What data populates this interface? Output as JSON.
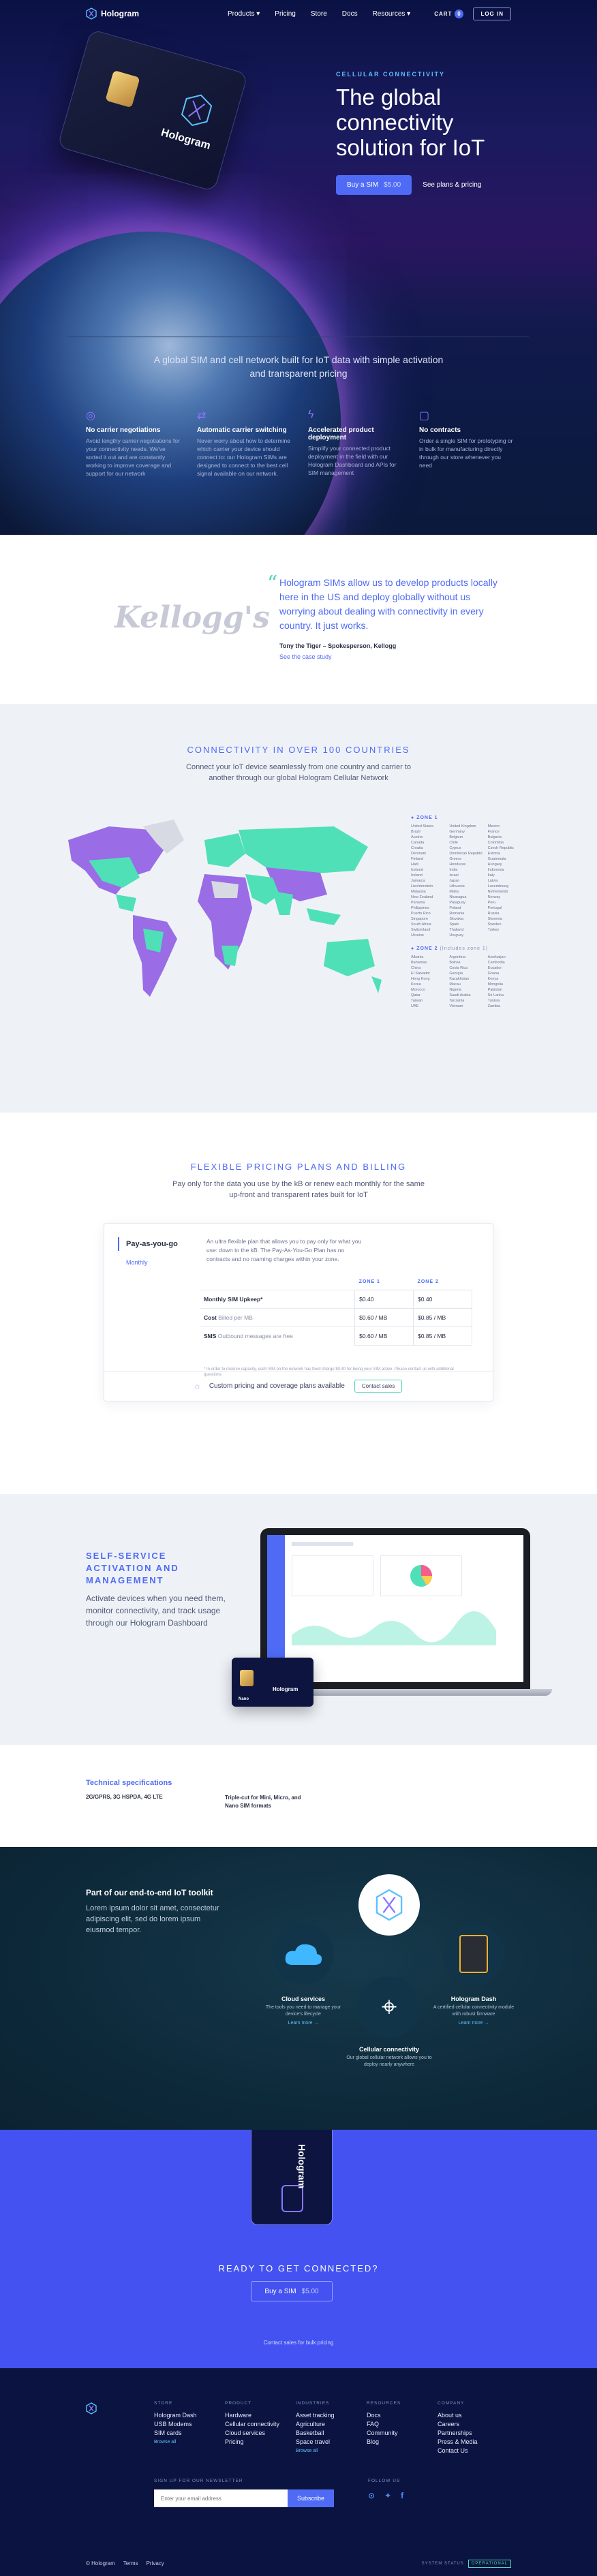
{
  "nav": {
    "brand": "Hologram",
    "links": [
      "Products",
      "Pricing",
      "Store",
      "Docs",
      "Resources"
    ],
    "cart": "CART",
    "cart_count": "0",
    "login": "LOG IN"
  },
  "hero": {
    "sim_label": "Hologram",
    "eyebrow": "CELLULAR CONNECTIVITY",
    "title": "The global connectivity solution for IoT",
    "buy_label": "Buy a SIM",
    "buy_price": "$5.00",
    "plans_link": "See plans & pricing",
    "subtitle": "A global SIM and cell network built for IoT data with simple activation and transparent pricing",
    "features": [
      {
        "icon": "globe-icon",
        "title": "No carrier negotiations",
        "text": "Avoid lengthy carrier negotiations for your connectivity needs. We've sorted it out and are constantly working to improve coverage and support for our network"
      },
      {
        "icon": "switch-icon",
        "title": "Automatic carrier switching",
        "text": "Never worry about how to determine which carrier your device should connect to: our Hologram SIMs are designed to connect to the best cell signal available on our network."
      },
      {
        "icon": "bolt-icon",
        "title": "Accelerated product deployment",
        "text": "Simplify your connected product deployment in the field with our Hologram Dashboard and APIs for SIM management"
      },
      {
        "icon": "contract-icon",
        "title": "No contracts",
        "text": "Order a single SIM for prototyping or in bulk for manufacturing directly through our store whenever you need"
      }
    ]
  },
  "testimonial": {
    "logo_text": "Kellogg's",
    "quote": "Hologram SIMs allow us to develop products locally here in the US and deploy globally without us worrying about dealing with connectivity in every country. It just works.",
    "author": "Tony the Tiger – Spokesperson, Kellogg",
    "case_link": "See the case study"
  },
  "coverage": {
    "title": "CONNECTIVITY IN OVER 100 COUNTRIES",
    "subtitle": "Connect your IoT device seamlessly from one country and carrier to another through our global Hologram Cellular Network",
    "zone1_title": "ZONE 1",
    "zone1": [
      "United States",
      "United Kingdom",
      "Mexico",
      "Brazil",
      "Germany",
      "France",
      "Austria",
      "Belgium",
      "Bulgaria",
      "Canada",
      "Chile",
      "Colombia",
      "Croatia",
      "Cyprus",
      "Czech Republic",
      "Denmark",
      "Dominican Republic",
      "Estonia",
      "Finland",
      "Greece",
      "Guatemala",
      "Haiti",
      "Honduras",
      "Hungary",
      "Iceland",
      "India",
      "Indonesia",
      "Ireland",
      "Israel",
      "Italy",
      "Jamaica",
      "Japan",
      "Latvia",
      "Liechtenstein",
      "Lithuania",
      "Luxembourg",
      "Malaysia",
      "Malta",
      "Netherlands",
      "New Zealand",
      "Nicaragua",
      "Norway",
      "Panama",
      "Paraguay",
      "Peru",
      "Philippines",
      "Poland",
      "Portugal",
      "Puerto Rico",
      "Romania",
      "Russia",
      "Singapore",
      "Slovakia",
      "Slovenia",
      "South Africa",
      "Spain",
      "Sweden",
      "Switzerland",
      "Thailand",
      "Turkey",
      "Ukraine",
      "Uruguay"
    ],
    "zone2_title": "ZONE 2",
    "zone2_note": "(Includes zone 1)",
    "zone2": [
      "Albania",
      "Argentina",
      "Azerbaijan",
      "Bahamas",
      "Bolivia",
      "Cambodia",
      "China",
      "Costa Rica",
      "Ecuador",
      "El Salvador",
      "Georgia",
      "Ghana",
      "Hong Kong",
      "Kazakhstan",
      "Kenya",
      "Korea",
      "Macau",
      "Mongolia",
      "Morocco",
      "Nigeria",
      "Pakistan",
      "Qatar",
      "Saudi Arabia",
      "Sri Lanka",
      "Taiwan",
      "Tanzania",
      "Tunisia",
      "UAE",
      "Vietnam",
      "Zambia"
    ]
  },
  "pricing": {
    "title": "FLEXIBLE PRICING PLANS AND BILLING",
    "subtitle": "Pay only for the data you use by the kB or renew each monthly for the same up-front and transparent rates built for IoT",
    "tab_active": "Pay-as-you-go",
    "tab_other": "Monthly",
    "description": "An ultra flexible plan that allows you to pay only for what you use: down to the kB. The Pay-As-You-Go Plan has no contracts and no roaming charges within your zone.",
    "zone1_header": "ZONE 1",
    "zone2_header": "ZONE 2",
    "rows": [
      {
        "label": "Monthly SIM Upkeep*",
        "note": "",
        "z1": "$0.40",
        "z2": "$0.40"
      },
      {
        "label": "Cost",
        "note": "Billed per MB",
        "z1": "$0.60 / MB",
        "z2": "$0.85 / MB"
      },
      {
        "label": "SMS",
        "note": "Outbound messages are free",
        "z1": "$0.60 / MB",
        "z2": "$0.85 / MB"
      }
    ],
    "footnote": "* In order to reserve capacity, each SIM on the network has fixed charge $0.40 for being your SIM active. Please contact us with additional questions.",
    "custom_text": "Custom pricing and coverage plans available",
    "contact_sales": "Contact sales"
  },
  "dashboard": {
    "title": "SELF-SERVICE ACTIVATION AND MANAGEMENT",
    "subtitle": "Activate devices when you need them, monitor connectivity, and track usage through our Hologram Dashboard",
    "sim_label": "Hologram",
    "sim_sub": "Nano"
  },
  "specs": {
    "title": "Technical specifications",
    "spec1": "2G/GPRS, 3G HSPDA, 4G LTE",
    "spec2": "Triple-cut for Mini, Micro, and Nano SIM formats"
  },
  "toolkit": {
    "title": "Part of our end-to-end IoT toolkit",
    "subtitle": "Lorem ipsum dolor sit amet, consectetur adipiscing elit, sed do  lorem ipsum eiusmod tempor.",
    "items": [
      {
        "title": "Cloud services",
        "text": "The tools you need to manage your device's lifecycle",
        "link": "Learn more →"
      },
      {
        "title": "Cellular connectivity",
        "text": "Our global cellular network allows you to deploy nearly anywhere",
        "link": ""
      },
      {
        "title": "Hologram Dash",
        "text": "A certified cellular connectivity module with robust firmware",
        "link": "Learn more →"
      }
    ]
  },
  "cta": {
    "sim_label": "Hologram",
    "title": "READY TO GET CONNECTED?",
    "buy_label": "Buy a SIM",
    "buy_price": "$5.00",
    "foot_link": "Contact sales for bulk pricing"
  },
  "footer": {
    "cols": [
      {
        "head": "STORE",
        "items": [
          "Hologram Dash",
          "USB Modems",
          "SIM cards",
          "Browse all"
        ]
      },
      {
        "head": "PRODUCT",
        "items": [
          "Hardware",
          "Cellular connectivity",
          "Cloud services",
          "Pricing"
        ]
      },
      {
        "head": "INDUSTRIES",
        "items": [
          "Asset tracking",
          "Agriculture",
          "Basketball",
          "Space travel",
          "Browse all"
        ]
      },
      {
        "head": "RESOURCES",
        "items": [
          "Docs",
          "FAQ",
          "Community",
          "Blog"
        ]
      },
      {
        "head": "COMPANY",
        "items": [
          "About us",
          "Careers",
          "Partnerships",
          "Press & Media",
          "Contact Us"
        ]
      }
    ],
    "newsletter_head": "SIGN UP FOR OUR NEWSLETTER",
    "email_placeholder": "Enter your email address",
    "subscribe": "Subscribe",
    "follow_head": "FOLLOW US",
    "copyright": "© Hologram",
    "terms": "Terms",
    "privacy": "Privacy",
    "status_label": "SYSTEM STATUS",
    "status_value": "OPERATIONAL"
  }
}
